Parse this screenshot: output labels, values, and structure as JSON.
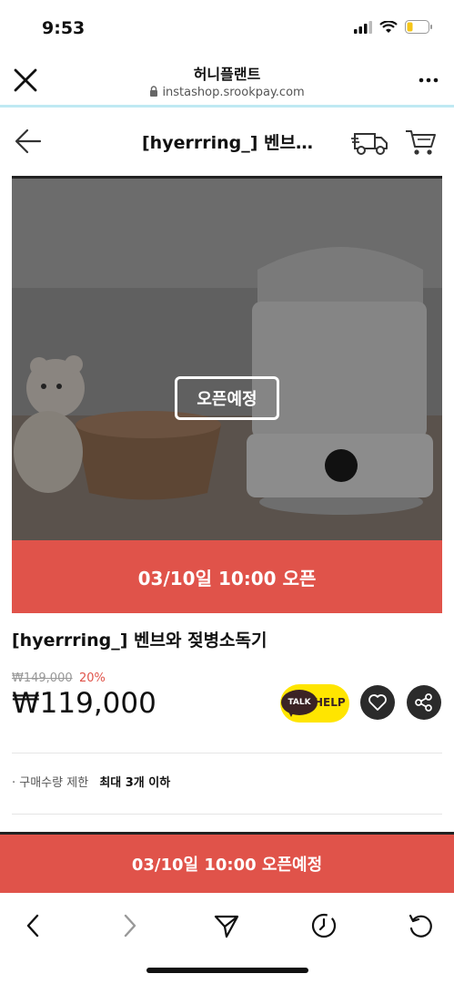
{
  "status_bar": {
    "time": "9:53"
  },
  "browser": {
    "title": "허니플랜트",
    "url": "instashop.srookpay.com"
  },
  "shop_header": {
    "title": "[hyerrring_] 벤브…"
  },
  "product": {
    "badge": "오픈예정",
    "open_bar": "03/10일 10:00 오픈",
    "name": "[hyerrring_] 벤브와 젖병소독기",
    "original_price": "₩149,000",
    "discount": "20%",
    "price": "₩119,000",
    "talk_label": "TALK",
    "help_label": "HELP",
    "limit_label": "· 구매수량 제한",
    "limit_value": "최대 3개 이하"
  },
  "cta": {
    "label": "03/10일 10:00 오픈예정"
  },
  "colors": {
    "accent": "#e0534a",
    "kakao": "#ffe500",
    "dark": "#2b2b2b"
  },
  "icons": [
    "close-icon",
    "lock-icon",
    "more-icon",
    "back-arrow-icon",
    "delivery-truck-icon",
    "cart-icon",
    "heart-icon",
    "share-icon",
    "prev-icon",
    "next-icon",
    "send-icon",
    "history-icon",
    "refresh-icon"
  ]
}
